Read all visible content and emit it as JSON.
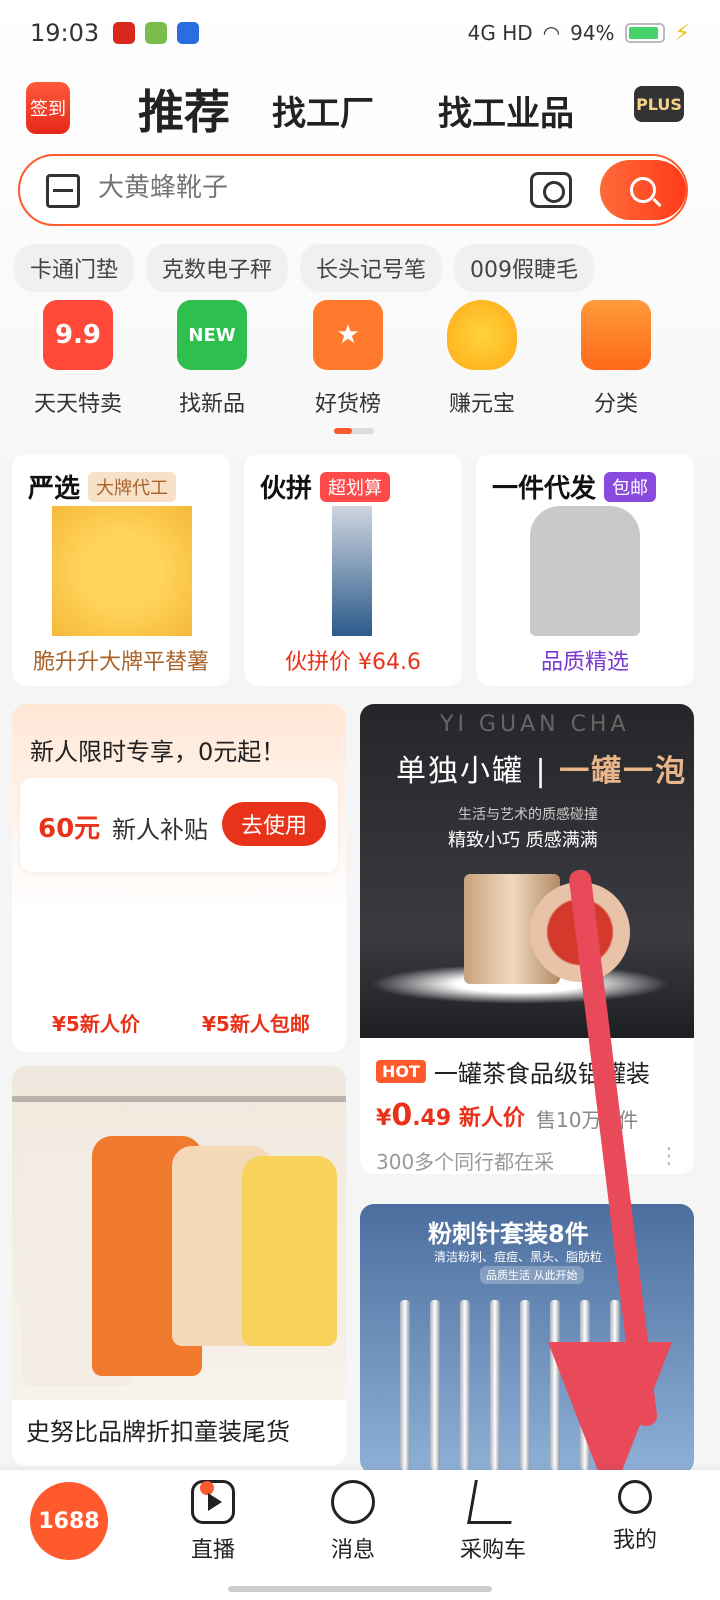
{
  "status": {
    "time": "19:03",
    "network": "4G HD",
    "battery": "94%"
  },
  "header": {
    "signin_label": "签到",
    "tabs": [
      "推荐",
      "找工厂",
      "找工业品"
    ],
    "plus_label": "PLUS"
  },
  "search": {
    "placeholder": "大黄蜂靴子"
  },
  "hot_searches": [
    "卡通门垫",
    "克数电子秤",
    "长头记号笔",
    "009假睫毛"
  ],
  "categories": [
    {
      "label": "天天特卖",
      "badge": "9.9"
    },
    {
      "label": "找新品",
      "badge": "NEW"
    },
    {
      "label": "好货榜",
      "badge": "★"
    },
    {
      "label": "赚元宝",
      "badge": ""
    },
    {
      "label": "分类",
      "badge": ""
    }
  ],
  "promo_cards": [
    {
      "title": "严选",
      "tag": "大牌代工",
      "footer": "脆升升大牌平替薯"
    },
    {
      "title": "伙拼",
      "tag": "超划算",
      "footer": "伙拼价 ¥64.6"
    },
    {
      "title": "一件代发",
      "tag": "包邮",
      "footer": "品质精选"
    }
  ],
  "newbie": {
    "headline": "新人限时专享，0元起！",
    "amount": "60元",
    "subsidy": "新人补贴",
    "use_button": "去使用",
    "price1": "¥5新人价",
    "price2": "¥5新人包邮"
  },
  "tea": {
    "en": "YI GUAN CHA",
    "line1a": "单独小罐",
    "line1b": "一罐一泡",
    "line2": "生活与艺术的质感碰撞",
    "line3": "精致小巧 质感满满",
    "badge": "HOT",
    "title": "一罐茶食品级铝罐装",
    "price_prefix": "¥",
    "price_main": "0",
    "price_decimal": ".49",
    "price_label": "新人价",
    "sold": "售10万+件",
    "peers": "300多个同行都在采",
    "more": "⋮"
  },
  "kids": {
    "title": "史努比品牌折扣童装尾货"
  },
  "tools": {
    "title": "粉刺针套装8件",
    "subtitle": "清洁粉刺、痘痘、黑头、脂肪粒",
    "label": "品质生活 从此开始"
  },
  "tabbar": {
    "home": "1688",
    "items": [
      "直播",
      "消息",
      "采购车",
      "我的"
    ]
  },
  "colors": {
    "accent": "#ff5a2d",
    "annotation_arrow": "#e84a5a"
  }
}
